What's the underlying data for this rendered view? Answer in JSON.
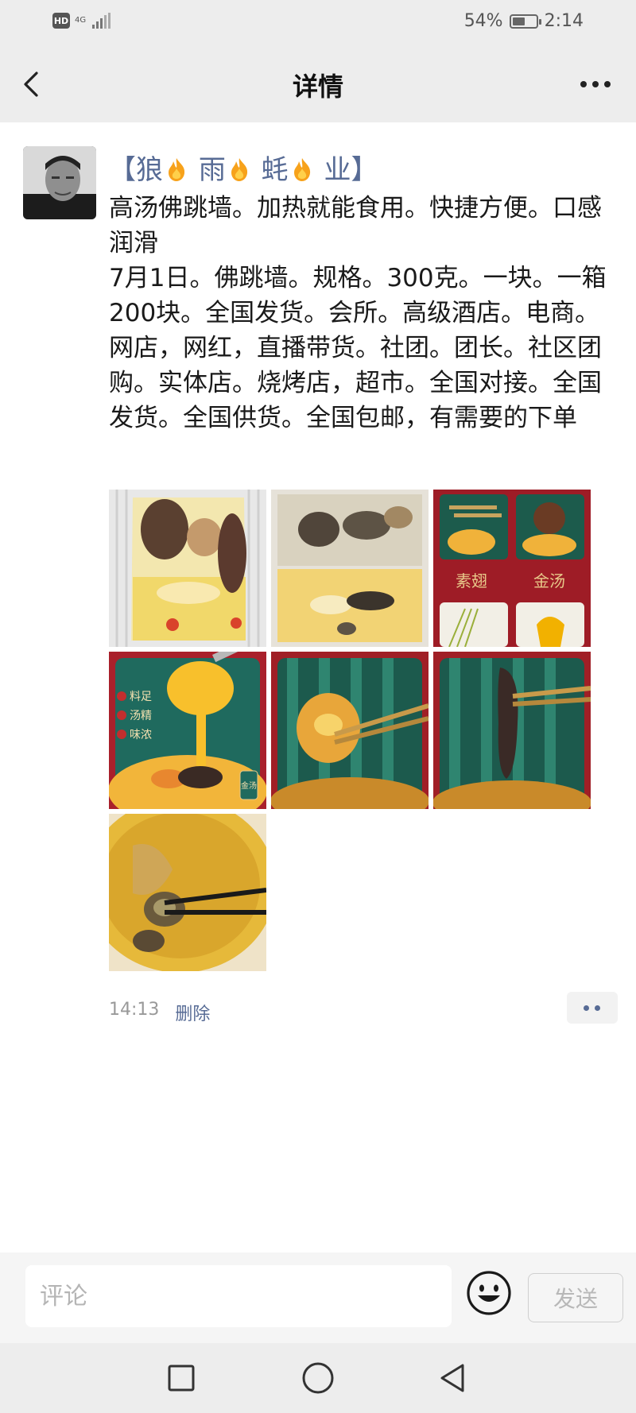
{
  "status_bar": {
    "hd_badge": "HD",
    "network": "4G",
    "battery_percent_text": "54%",
    "battery_level": 0.54,
    "time": "2:14"
  },
  "nav": {
    "title": "详情",
    "back_icon": "chevron-left-icon",
    "more_icon": "more-dots-icon"
  },
  "post": {
    "author": {
      "open_bracket": "【",
      "part1": "狼",
      "part2": "雨",
      "part3": "蚝",
      "part4": "业",
      "close_bracket": "】",
      "emoji_icon": "flame-icon",
      "color": "#576b95"
    },
    "text": "高汤佛跳墙。加热就能食用。快捷方便。口感润滑\n7月1日。佛跳墙。规格。300克。一块。一箱200块。全国发货。会所。高级酒店。电商。网店，网红，直播带货。社团。团长。社区团购。实体店。烧烤店，超市。全国对接。全国发货。全国供货。全国包邮，有需要的下单",
    "photos": [
      {
        "name": "photo-1",
        "content": "vacuum-packed-soup"
      },
      {
        "name": "photo-2",
        "content": "packed-abalone-sea-cucumber"
      },
      {
        "name": "photo-3",
        "content": "collage",
        "label_left": "素翅",
        "label_right": "金汤"
      },
      {
        "name": "photo-4",
        "content": "golden-soup-pour",
        "tags": [
          "料足",
          "汤精",
          "味浓"
        ],
        "badge": "金汤"
      },
      {
        "name": "photo-5",
        "content": "abalone-chopsticks"
      },
      {
        "name": "photo-6",
        "content": "sea-cucumber-chopsticks"
      },
      {
        "name": "photo-7",
        "content": "bowl-of-soup"
      }
    ],
    "time": "14:13",
    "delete_label": "删除"
  },
  "comment_bar": {
    "placeholder": "评论",
    "emoji_icon": "smiley-icon",
    "send_label": "发送"
  },
  "system_nav": {
    "recent_icon": "square-icon",
    "home_icon": "circle-icon",
    "back_icon": "triangle-back-icon"
  },
  "colors": {
    "link": "#576b95",
    "bar_bg": "#ededed"
  }
}
